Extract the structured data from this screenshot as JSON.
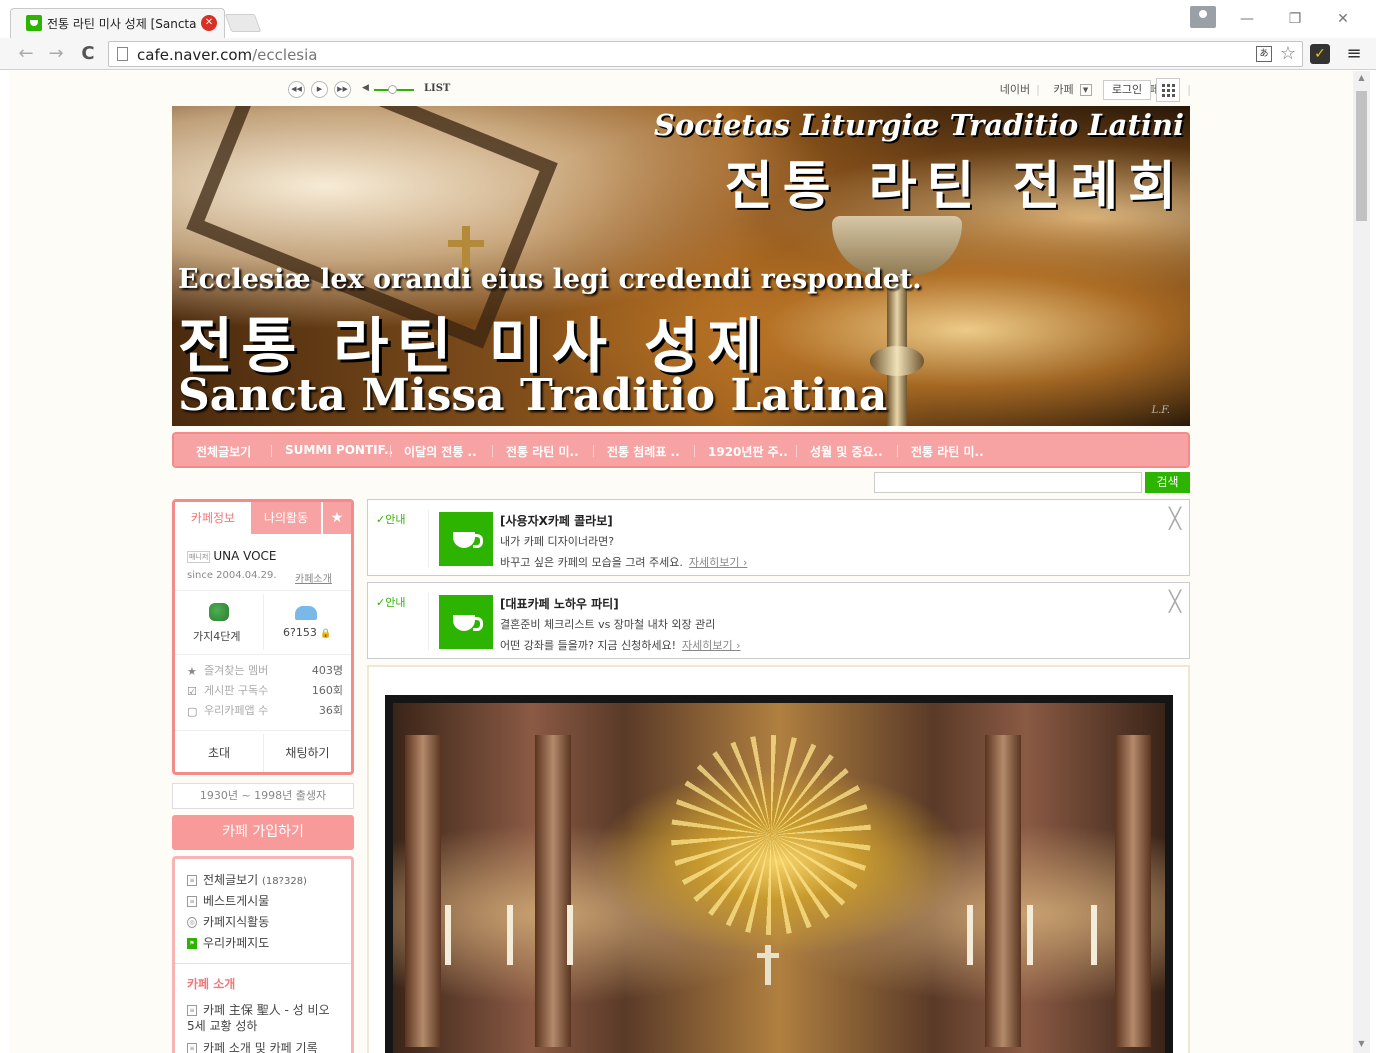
{
  "browser": {
    "tab_title": "전통 라틴 미사 성제 [Sancta Missa Traditio Latina]",
    "tab_close": "✕",
    "url_host": "cafe.naver.com",
    "url_path": "/ecclesia",
    "back": "←",
    "forward": "→",
    "reload": "C",
    "minimize": "—",
    "restore": "❐",
    "close": "✕",
    "translate": "あ",
    "star": "☆",
    "ext": "✓",
    "menu": "≡"
  },
  "player": {
    "prev": "◀◀",
    "play": "▶",
    "next": "▶▶",
    "volume_icon": "◀",
    "list_label": "LIST"
  },
  "gnb": {
    "naver": "네이버",
    "cafe": "카페",
    "joined_cafe": "가입카페",
    "login": "로그인"
  },
  "banner": {
    "latin_title": "Societas Liturgiæ Traditio Latini",
    "korean_title": "전통 라틴 전례회",
    "motto": "Ecclesiæ lex orandi eius legi credendi respondet.",
    "korean_subtitle": "전통 라틴 미사 성제",
    "latin_subtitle": "Sancta Missa Traditio Latina",
    "signature": "L.F."
  },
  "menubar": {
    "items": [
      "전체글보기",
      "SUMMI PONTIF..",
      "이달의 전통 ..",
      "전통 라틴 미..",
      "전통 첨례표 ..",
      "1920년판 주..",
      "성월 및 중요..",
      "전통 라틴 미.."
    ]
  },
  "search": {
    "placeholder": "",
    "button": "검색"
  },
  "sidebar": {
    "tab_info": "카페정보",
    "tab_activity": "나의활동",
    "tab_star": "★",
    "manager_badge": "매니저",
    "manager_name": "UNA VOCE",
    "since": "since 2004.04.29.",
    "intro_link": "카페소개",
    "level": "가지4단계",
    "members": "6?153",
    "members_lock": "🔒",
    "rows": [
      {
        "icon": "★",
        "label": "즐겨찾는 멤버",
        "value": "403명"
      },
      {
        "icon": "☑",
        "label": "게시판 구독수",
        "value": "160회"
      },
      {
        "icon": "▢",
        "label": "우리카페앱 수",
        "value": "36회"
      }
    ],
    "invite": "초대",
    "chat": "채팅하기",
    "generation": "1930년 ~ 1998년 출생자",
    "join": "카페 가입하기",
    "menu": [
      {
        "label": "전체글보기",
        "count": "(18?328)"
      },
      {
        "label": "베스트게시물",
        "count": ""
      },
      {
        "label": "카페지식활동",
        "count": ""
      },
      {
        "label": "우리카페지도",
        "count": ""
      }
    ],
    "category": "카페 소개",
    "category_items": [
      "카페 主保 聖人 - 성 비오",
      "5세 교황 성하",
      "카페 소개 및 카페 기록"
    ]
  },
  "notices": [
    {
      "badge": "✓안내",
      "title": "[사용자X카페 콜라보]",
      "line1": "내가 카페 디자이너라면?",
      "line2": "바꾸고 싶은 카페의 모습을 그려 주세요.",
      "more": "자세히보기 ›",
      "close": "╳"
    },
    {
      "badge": "✓안내",
      "title": "[대표카페 노하우 파티]",
      "line1": "결혼준비 체크리스트 vs 장마철 내차 외장 관리",
      "line2": "어떤 강좌를 들을까? 지금 신청하세요!",
      "more": "자세히보기 ›",
      "close": "╳"
    }
  ],
  "colors": {
    "accent_pink": "#f8a3a3",
    "naver_green": "#2db400",
    "page_bg": "#fdfcf6"
  }
}
